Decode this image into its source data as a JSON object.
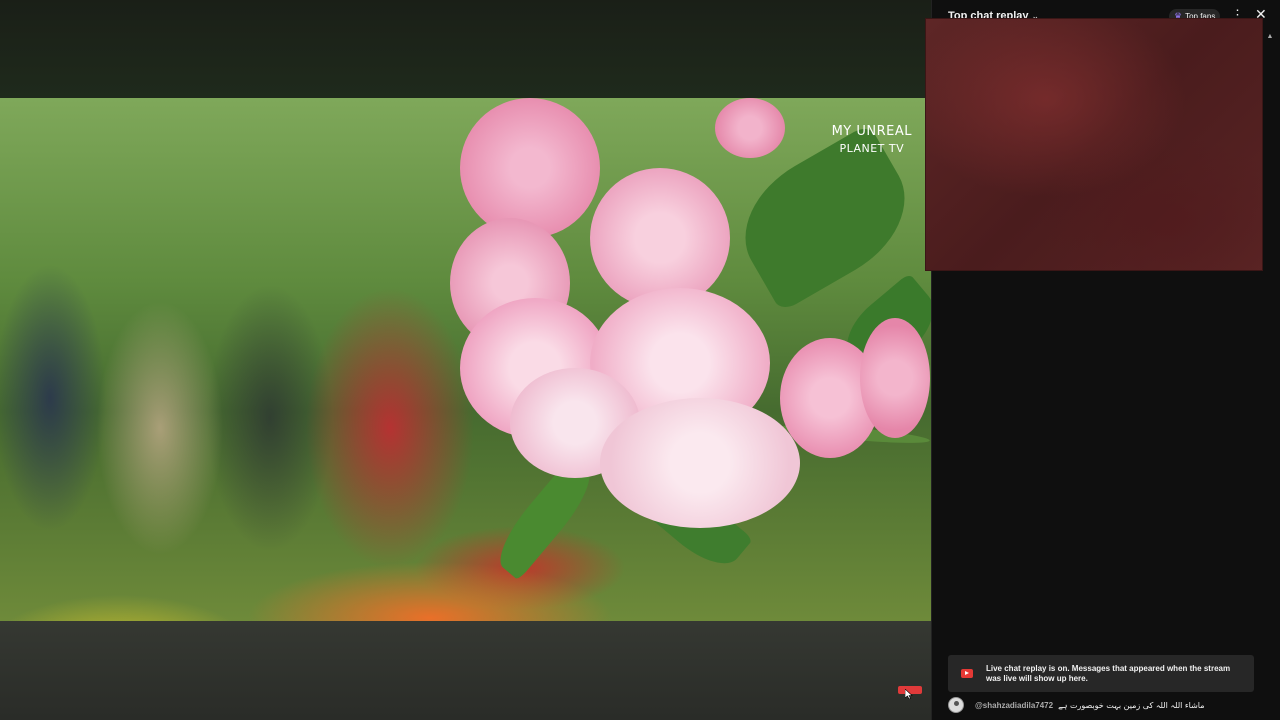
{
  "video": {
    "watermark_line1": "MY UNREAL",
    "watermark_line2": "PLANET TV"
  },
  "chat": {
    "title": "Top chat replay",
    "chevron_icon": "chevron-down-icon",
    "top_fans_label": "Top fans",
    "menu_icon": "more-vert-icon",
    "close_icon": "close-icon",
    "info_text": "Live chat replay is on. Messages that appeared when the stream was live will show up here.",
    "messages": [
      {
        "author": "@shahzadiadila7472",
        "text": "ماشاء اللہ اللہ کی زمین بہت خوبصورت ہے"
      }
    ]
  },
  "colors": {
    "accent_red": "#e53935",
    "panel_bg": "#0f0f0f",
    "info_bg": "#272727"
  }
}
